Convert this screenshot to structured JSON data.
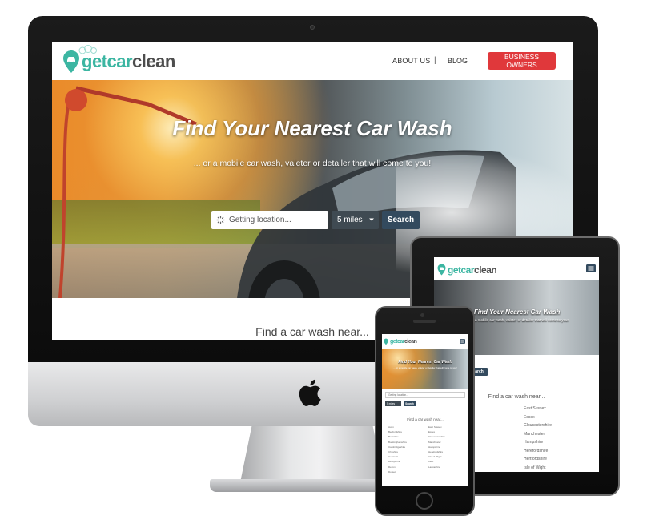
{
  "brand": {
    "logo_prefix": "get",
    "logo_car": "car",
    "logo_suffix": "clean",
    "accent": "#3cb6a2",
    "dark": "#4d4d4d",
    "cta_color": "#e0383b",
    "button_color": "#334a5e"
  },
  "nav": {
    "about": "ABOUT US",
    "separator": "|",
    "blog": "BLOG",
    "business": "BUSINESS OWNERS"
  },
  "hero": {
    "title": "Find Your Nearest Car Wash",
    "subtitle": "... or a mobile car wash, valeter or detailer that will come to you!",
    "location_placeholder": "Getting location...",
    "miles": "5 miles",
    "search": "Search"
  },
  "section": {
    "find_near": "Find a car wash near..."
  },
  "ipad": {
    "hero_title": "Find Your Nearest Car Wash",
    "hero_sub": "... a mobile car wash, valeter or detailer that will come to you!",
    "search": "Search",
    "find_near": "Find a car wash near...",
    "counties": [
      "East Sussex",
      "Essex",
      "Gloucestershire",
      "Manchester",
      "Hampshire",
      "Herefordshire",
      "Hertfordshire",
      "Isle of Wight"
    ]
  },
  "iphone": {
    "hero_title": "Find Your Nearest Car Wash",
    "hero_sub": "... or a mobile car wash, valeter or detailer that will come to you!",
    "location_placeholder": "Getting location...",
    "miles": "5 miles",
    "search": "Search",
    "find_near": "Find a car wash near...",
    "counties_left": [
      "Avon",
      "Bedfordshire",
      "Berkshire",
      "Buckinghamshire",
      "Cambridgeshire",
      "Cheshire",
      "Cornwall",
      "Derbyshire",
      "Devon",
      "Dorset"
    ],
    "counties_right": [
      "East Sussex",
      "Essex",
      "Gloucestershire",
      "Manchester",
      "Hampshire",
      "Herefordshire",
      "Isle of Wight",
      "Kent",
      "Lancashire"
    ]
  }
}
